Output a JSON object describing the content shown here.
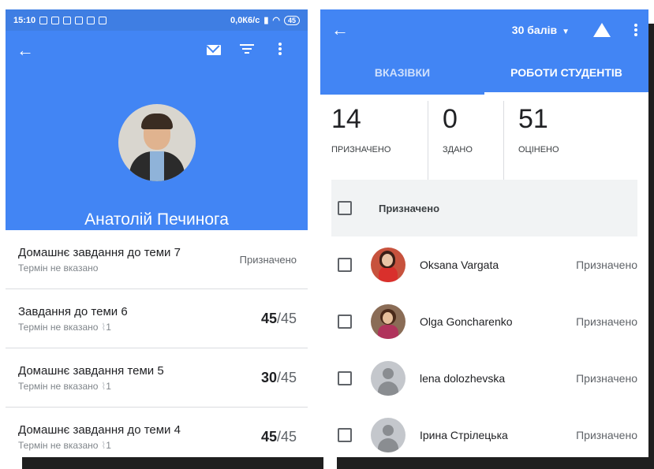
{
  "left": {
    "status_bar": {
      "time": "15:10",
      "speed": "0,0К6/с",
      "battery": "45"
    },
    "name": "Анатолій Печинога",
    "assignments": [
      {
        "title": "Домашнє завдання до теми 7",
        "sub": "Термін не вказано",
        "status": "Призначено"
      },
      {
        "title": "Завдання до теми 6",
        "sub": "Термін не вказано",
        "attachments": "1",
        "score": "45",
        "max": "/45"
      },
      {
        "title": "Домашнє завдання теми 5",
        "sub": "Термін не вказано",
        "attachments": "1",
        "score": "30",
        "max": "/45"
      },
      {
        "title": "Домашнє завдання до теми 4",
        "sub": "Термін не вказано",
        "attachments": "1",
        "score": "45",
        "max": "/45"
      }
    ]
  },
  "right": {
    "points": "30 балів",
    "tabs": [
      "ВКАЗІВКИ",
      "РОБОТИ СТУДЕНТІВ"
    ],
    "stats": [
      {
        "num": "14",
        "label": "ПРИЗНАЧЕНО"
      },
      {
        "num": "0",
        "label": "ЗДАНО"
      },
      {
        "num": "51",
        "label": "ОЦІНЕНО"
      }
    ],
    "group_label": "Призначено",
    "students": [
      {
        "name": "Oksana Vargata",
        "status": "Призначено"
      },
      {
        "name": "Olga Goncharenko",
        "status": "Призначено"
      },
      {
        "name": "lena dolozhevska",
        "status": "Призначено"
      },
      {
        "name": "Ірина Стрілецька",
        "status": "Призначено"
      }
    ]
  },
  "colors": {
    "primary": "#4285f4",
    "status_bar": "#3f7ee3"
  },
  "icons": [
    "back-arrow-icon",
    "mail-icon",
    "filter-icon",
    "more-vert-icon",
    "drive-icon",
    "dropdown-caret-icon",
    "attachment-icon",
    "checkbox-icon"
  ]
}
